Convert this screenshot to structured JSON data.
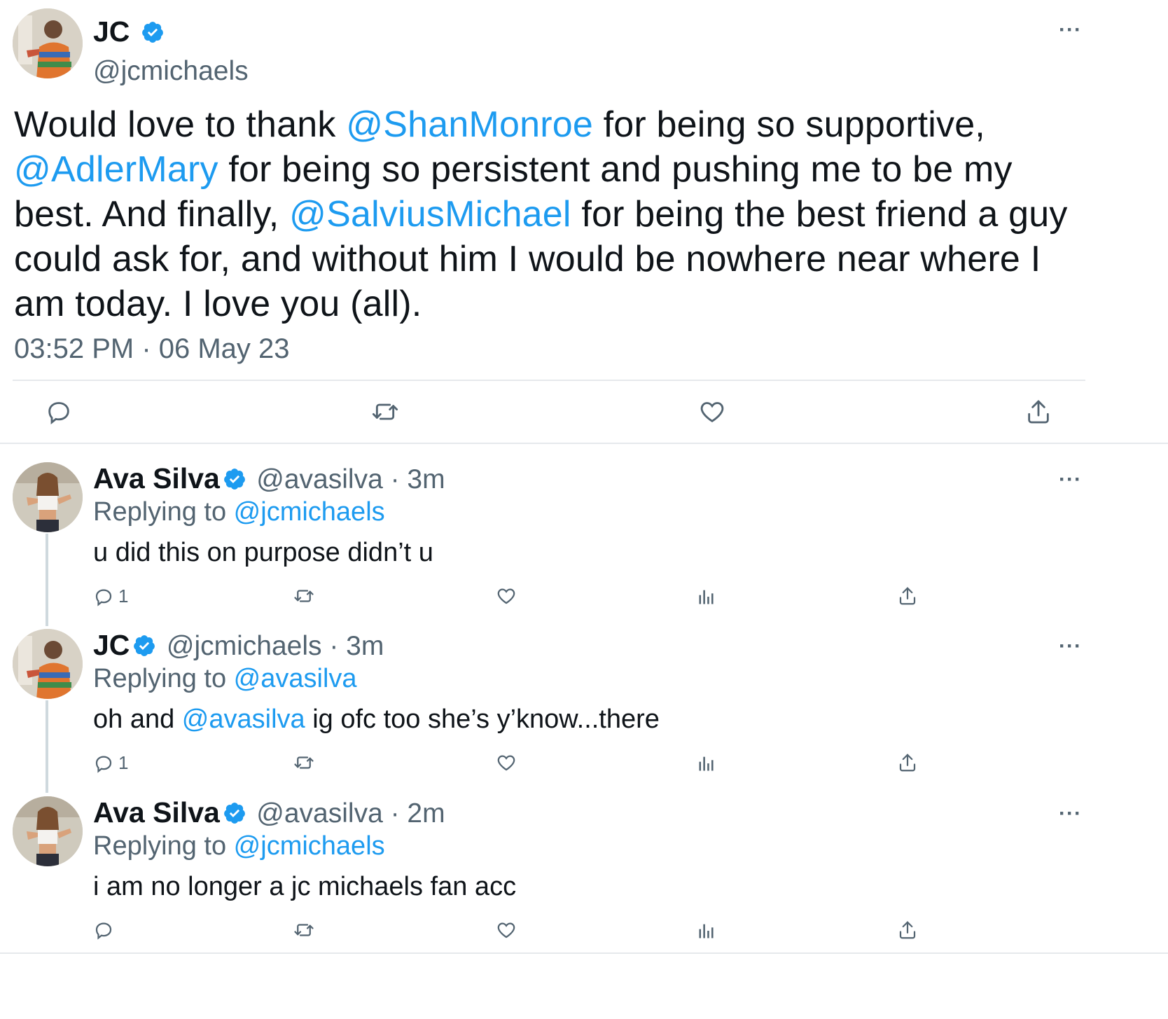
{
  "main_tweet": {
    "display_name": "JC",
    "handle": "@jcmichaels",
    "text_parts": [
      {
        "t": "Would love to thank "
      },
      {
        "t": "@ShanMonroe",
        "mention": true
      },
      {
        "t": " for being so supportive, "
      },
      {
        "t": "@AdlerMary",
        "mention": true
      },
      {
        "t": " for being so persistent and pushing me to be my best. And finally, "
      },
      {
        "t": "@SalviusMichael",
        "mention": true
      },
      {
        "t": " for being the best friend a guy could ask for, and without him I would be nowhere near where I am today. I love you (all)."
      }
    ],
    "timestamp": "03:52 PM · 06 May 23",
    "more_label": "···"
  },
  "replies": [
    {
      "display_name": "Ava Silva",
      "handle_time": "@avasilva · 3m",
      "replying_prefix": "Replying to ",
      "replying_to": "@jcmichaels",
      "text_parts": [
        {
          "t": "u did this on purpose didn’t u"
        }
      ],
      "reply_count": "1",
      "more_label": "···"
    },
    {
      "display_name": "JC",
      "handle_time": "@jcmichaels · 3m",
      "replying_prefix": "Replying to ",
      "replying_to": "@avasilva",
      "text_parts": [
        {
          "t": "oh and "
        },
        {
          "t": "@avasilva",
          "mention": true
        },
        {
          "t": " ig ofc too she’s y’know...there"
        }
      ],
      "reply_count": "1",
      "more_label": "···"
    },
    {
      "display_name": "Ava Silva",
      "handle_time": "@avasilva · 2m",
      "replying_prefix": "Replying to ",
      "replying_to": "@jcmichaels",
      "text_parts": [
        {
          "t": "i am no longer a jc michaels fan acc"
        }
      ],
      "reply_count": "",
      "more_label": "···"
    }
  ],
  "colors": {
    "accent": "#1d9bf0",
    "secondary_text": "#536471",
    "divider": "#e6e9ec"
  },
  "icons": {
    "reply": "reply-icon",
    "retweet": "retweet-icon",
    "like": "heart-icon",
    "views": "analytics-icon",
    "share": "share-icon",
    "verified": "verified-badge-icon"
  }
}
